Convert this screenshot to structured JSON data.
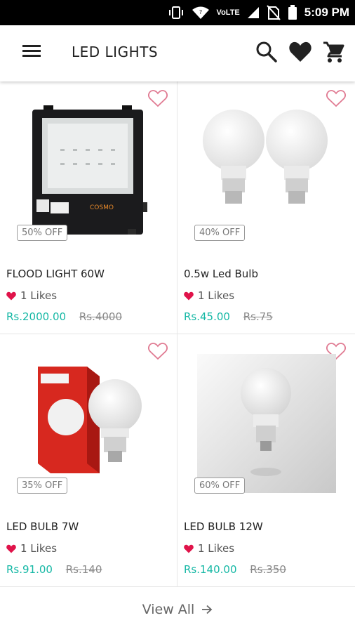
{
  "status_bar": {
    "time": "5:09 PM",
    "network_label": "VoLTE",
    "icons": [
      "vibrate-icon",
      "wifi-icon",
      "signal-icon",
      "no-sim-icon",
      "battery-icon"
    ]
  },
  "app_bar": {
    "title": "LED LIGHTS",
    "icons": [
      "menu-icon",
      "search-icon",
      "wishlist-heart-icon",
      "cart-icon"
    ]
  },
  "products": [
    {
      "name": "FLOOD LIGHT 60W",
      "discount": "50% OFF",
      "likes": "1 Likes",
      "price": "Rs.2000.00",
      "mrp": "Rs.4000",
      "image": "flood-light-image"
    },
    {
      "name": "0.5w Led Bulb",
      "discount": "40% OFF",
      "likes": "1 Likes",
      "price": "Rs.45.00",
      "mrp": "Rs.75",
      "image": "led-bulb-pair-image"
    },
    {
      "name": "LED BULB 7W",
      "discount": "35% OFF",
      "likes": "1 Likes",
      "price": "Rs.91.00",
      "mrp": "Rs.140",
      "image": "led-bulb-box-image"
    },
    {
      "name": "LED BULB 12W",
      "discount": "60% OFF",
      "likes": "1 Likes",
      "price": "Rs.140.00",
      "mrp": "Rs.350",
      "image": "led-bulb-12w-image"
    }
  ],
  "view_all": {
    "label": "View All"
  },
  "colors": {
    "accent_price": "#16b8a5",
    "like_heart": "#e0134a",
    "wish_outline": "#e07a92"
  }
}
